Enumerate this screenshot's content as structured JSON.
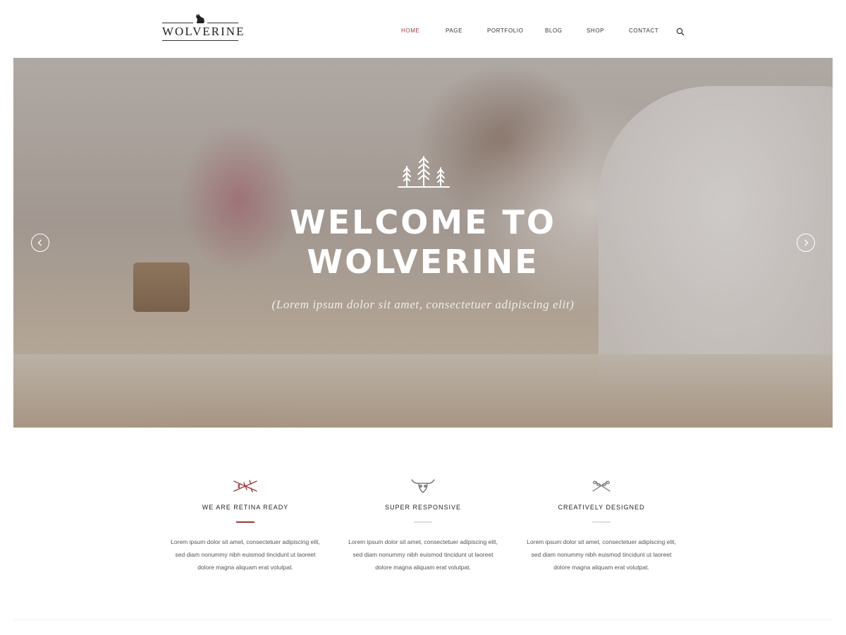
{
  "header": {
    "logo_text": "WOLVERINE",
    "nav": [
      {
        "label": "HOME",
        "active": true
      },
      {
        "label": "PAGE",
        "active": false
      },
      {
        "label": "PORTFOLIO",
        "active": false
      },
      {
        "label": "BLOG",
        "active": false
      },
      {
        "label": "SHOP",
        "active": false
      },
      {
        "label": "CONTACT",
        "active": false
      }
    ],
    "search_icon": "search-icon"
  },
  "hero": {
    "icon": "trees-icon",
    "title_line1": "WELCOME TO",
    "title_line2": "WOLVERINE",
    "subtitle": "(Lorem ipsum dolor sit amet, consectetuer adipiscing elit)",
    "prev_icon": "chevron-left-icon",
    "next_icon": "chevron-right-icon"
  },
  "features": [
    {
      "icon": "branch-icon",
      "title": "WE ARE RETINA READY",
      "text_line1": "Lorem ipsum dolor sit amet, consectetuer adipiscing elit,",
      "text_line2": "sed diam nonummy nibh euismod tincidunt ut laoreet",
      "text_line3": "dolore magna aliquam erat volutpat."
    },
    {
      "icon": "bull-skull-icon",
      "title": "SUPER RESPONSIVE",
      "text_line1": "Lorem ipsum dolor sit amet, consectetuer adipiscing elit,",
      "text_line2": "sed diam nonummy nibh euismod tincidunt ut laoreet",
      "text_line3": "dolore magna aliquam erat volutpat."
    },
    {
      "icon": "leaves-icon",
      "title": "CREATIVELY DESIGNED",
      "text_line1": "Lorem ipsum dolor sit amet, consectetuer adipiscing elit,",
      "text_line2": "sed diam nonummy nibh euismod tincidunt ut laoreet",
      "text_line3": "dolore magna aliquam erat volutpat."
    }
  ],
  "colors": {
    "accent": "#9b3a3a",
    "text": "#333333",
    "background": "#ffffff"
  }
}
